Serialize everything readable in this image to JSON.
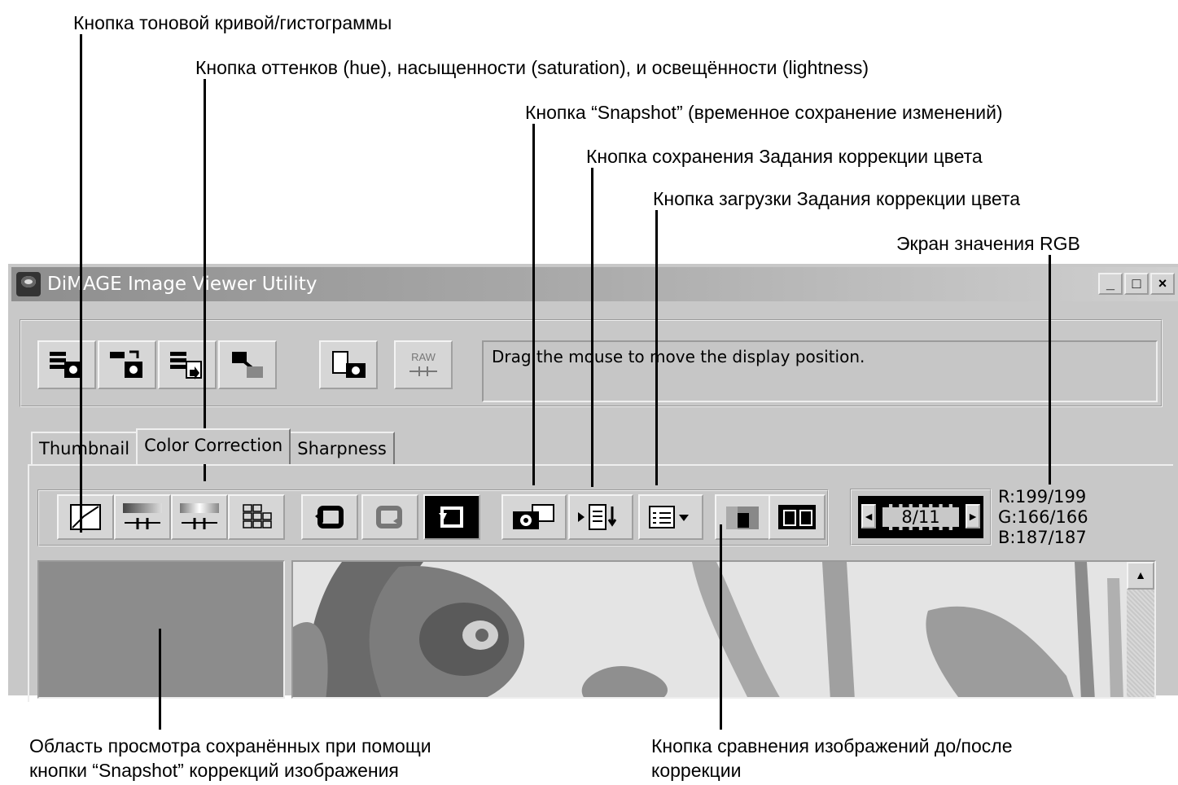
{
  "callouts": {
    "tone_curve": "Кнопка тоновой кривой/гистограммы",
    "hsl": "Кнопка оттенков (hue), насыщенности (saturation), и освещённости (lightness)",
    "snapshot": "Кнопка “Snapshot” (временное сохранение изменений)",
    "save_job": "Кнопка сохранения Задания коррекции цвета",
    "load_job": "Кнопка загрузки Задания коррекции цвета",
    "rgb_display": "Экран значения RGB",
    "snapshot_area": "Область просмотра сохранённых при помощи",
    "snapshot_area_2": "кнопки “Snapshot” коррекций изображения",
    "compare": "Кнопка сравнения изображений до/после",
    "compare_2": "коррекции"
  },
  "window": {
    "title": "DiMAGE Image Viewer Utility",
    "min": "_",
    "max": "□",
    "close": "×"
  },
  "toolbar": {
    "raw_label": "RAW",
    "status": "Drag the mouse to move the display position."
  },
  "tabs": [
    "Thumbnail",
    "Color Correction",
    "Sharpness"
  ],
  "active_tab": "Color Correction",
  "navigator": {
    "counter": "8/11",
    "prev": "◄",
    "next": "►"
  },
  "rgb": {
    "r": "R:199/199",
    "g": "G:166/166",
    "b": "B:187/187"
  },
  "scroll_up": "▲",
  "icons": [
    "tone-curve-icon",
    "hsl-color-icon",
    "hsl-gradient-icon",
    "variations-grid-icon",
    "undo-icon",
    "redo-icon",
    "reset-icon",
    "snapshot-camera-icon",
    "save-job-icon",
    "load-job-icon",
    "compare-icon",
    "full-screen-compare-icon"
  ]
}
